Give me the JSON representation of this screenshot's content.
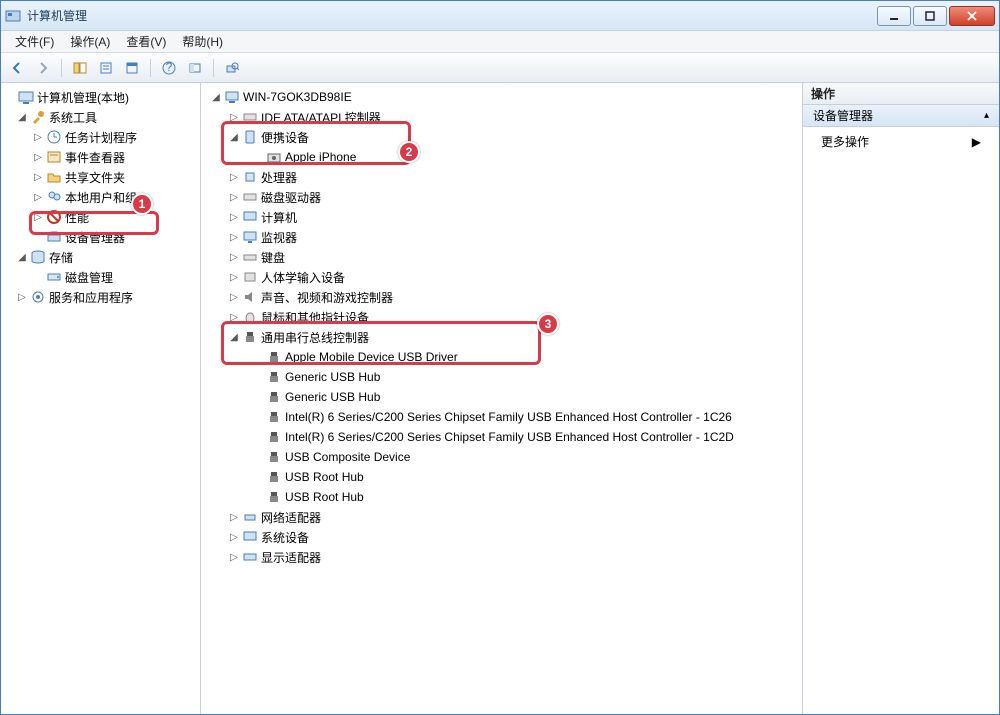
{
  "window": {
    "title": "计算机管理"
  },
  "menu": {
    "file": "文件(F)",
    "action": "操作(A)",
    "view": "查看(V)",
    "help": "帮助(H)"
  },
  "left_tree": {
    "root": "计算机管理(本地)",
    "system_tools": "系统工具",
    "task_scheduler": "任务计划程序",
    "event_viewer": "事件查看器",
    "shared_folders": "共享文件夹",
    "local_users": "本地用户和组",
    "performance": "性能",
    "device_manager": "设备管理器",
    "storage": "存储",
    "disk_mgmt": "磁盘管理",
    "services_apps": "服务和应用程序"
  },
  "center_tree": {
    "root": "WIN-7GOK3DB98IE",
    "ide": "IDE ATA/ATAPI 控制器",
    "portable": "便携设备",
    "apple_iphone": "Apple iPhone",
    "processors": "处理器",
    "disk_drives": "磁盘驱动器",
    "computer": "计算机",
    "monitors": "监视器",
    "keyboards": "键盘",
    "hid": "人体学输入设备",
    "sound": "声音、视频和游戏控制器",
    "mice": "鼠标和其他指针设备",
    "usb_controllers": "通用串行总线控制器",
    "usb_items": [
      "Apple Mobile Device USB Driver",
      "Generic USB Hub",
      "Generic USB Hub",
      "Intel(R) 6 Series/C200 Series Chipset Family USB Enhanced Host Controller - 1C26",
      "Intel(R) 6 Series/C200 Series Chipset Family USB Enhanced Host Controller - 1C2D",
      "USB Composite Device",
      "USB Root Hub",
      "USB Root Hub"
    ],
    "network": "网络适配器",
    "system_devices": "系统设备",
    "display": "显示适配器"
  },
  "right_panel": {
    "header": "操作",
    "section": "设备管理器",
    "more": "更多操作"
  },
  "annotations": {
    "b1": "1",
    "b2": "2",
    "b3": "3"
  }
}
